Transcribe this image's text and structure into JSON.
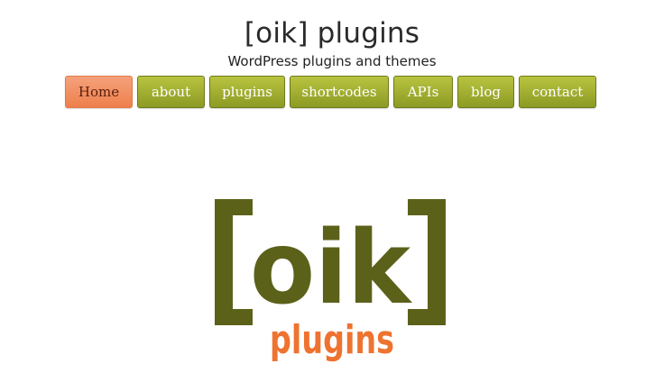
{
  "header": {
    "title": "[oik] plugins",
    "description": "WordPress plugins and themes"
  },
  "nav": {
    "items": [
      {
        "label": "Home",
        "active": true
      },
      {
        "label": "about",
        "active": false
      },
      {
        "label": "plugins",
        "active": false
      },
      {
        "label": "shortcodes",
        "active": false
      },
      {
        "label": "APIs",
        "active": false
      },
      {
        "label": "blog",
        "active": false
      },
      {
        "label": "contact",
        "active": false
      }
    ]
  },
  "logo": {
    "main_text": "oik",
    "sub_text": "plugins"
  },
  "colors": {
    "nav_green": "#9aa62c",
    "nav_active_orange": "#f08a5a",
    "logo_olive": "#5c611a",
    "logo_orange": "#ee7330"
  }
}
